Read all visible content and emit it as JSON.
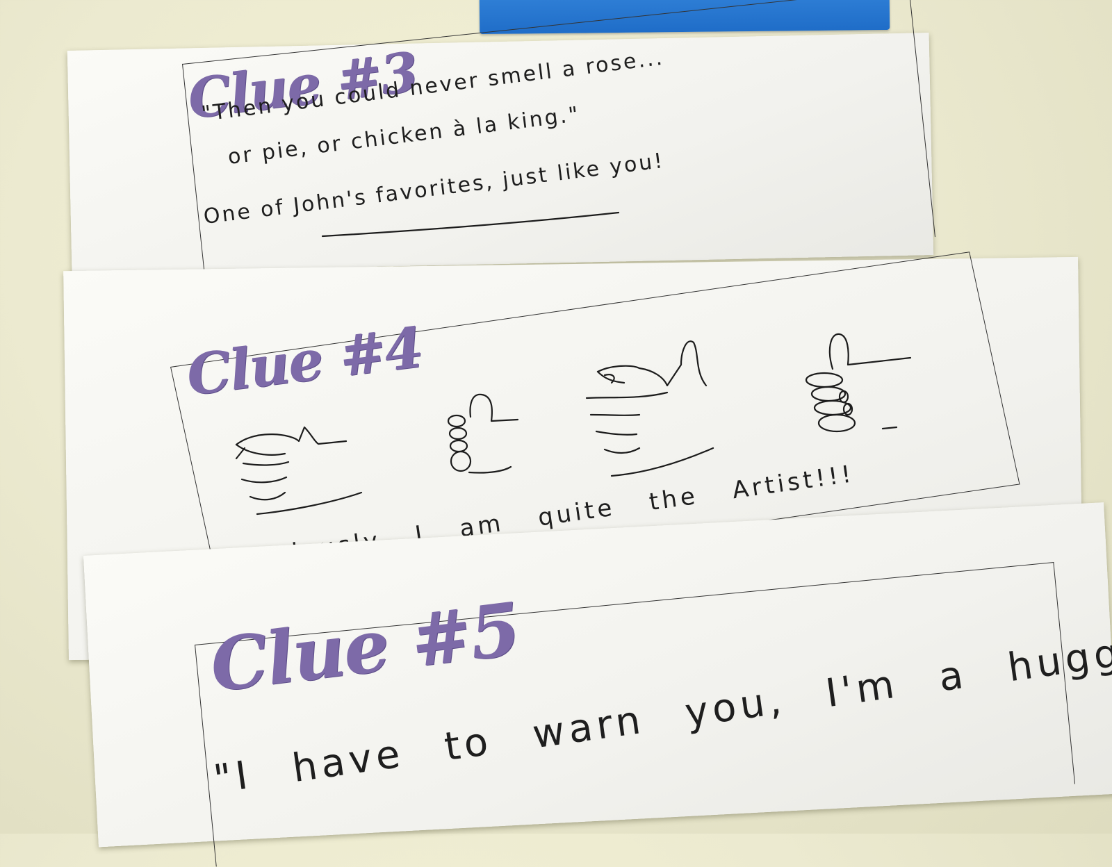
{
  "clue3": {
    "title": "Clue #3",
    "line1": "\"Then you could never smell a rose...",
    "line2": "or pie, or chicken à la king.\"",
    "line3": "One of John's favorites, just like you!"
  },
  "clue4": {
    "title": "Clue #4",
    "caption": "Obviously I am quite the Artist!!!",
    "drawings": [
      "thumbs-up-sketch",
      "thumbs-up-sketch",
      "thumbs-up-sketch",
      "thumbs-up-sketch"
    ]
  },
  "clue5": {
    "title": "Clue #5",
    "line1": "\"I have to warn you, I'm a hugger!\""
  },
  "colors": {
    "title_purple": "#7d6aa8",
    "tape_blue": "#2f7fd6",
    "ink": "#1e1e1e",
    "background": "#efedd2"
  }
}
